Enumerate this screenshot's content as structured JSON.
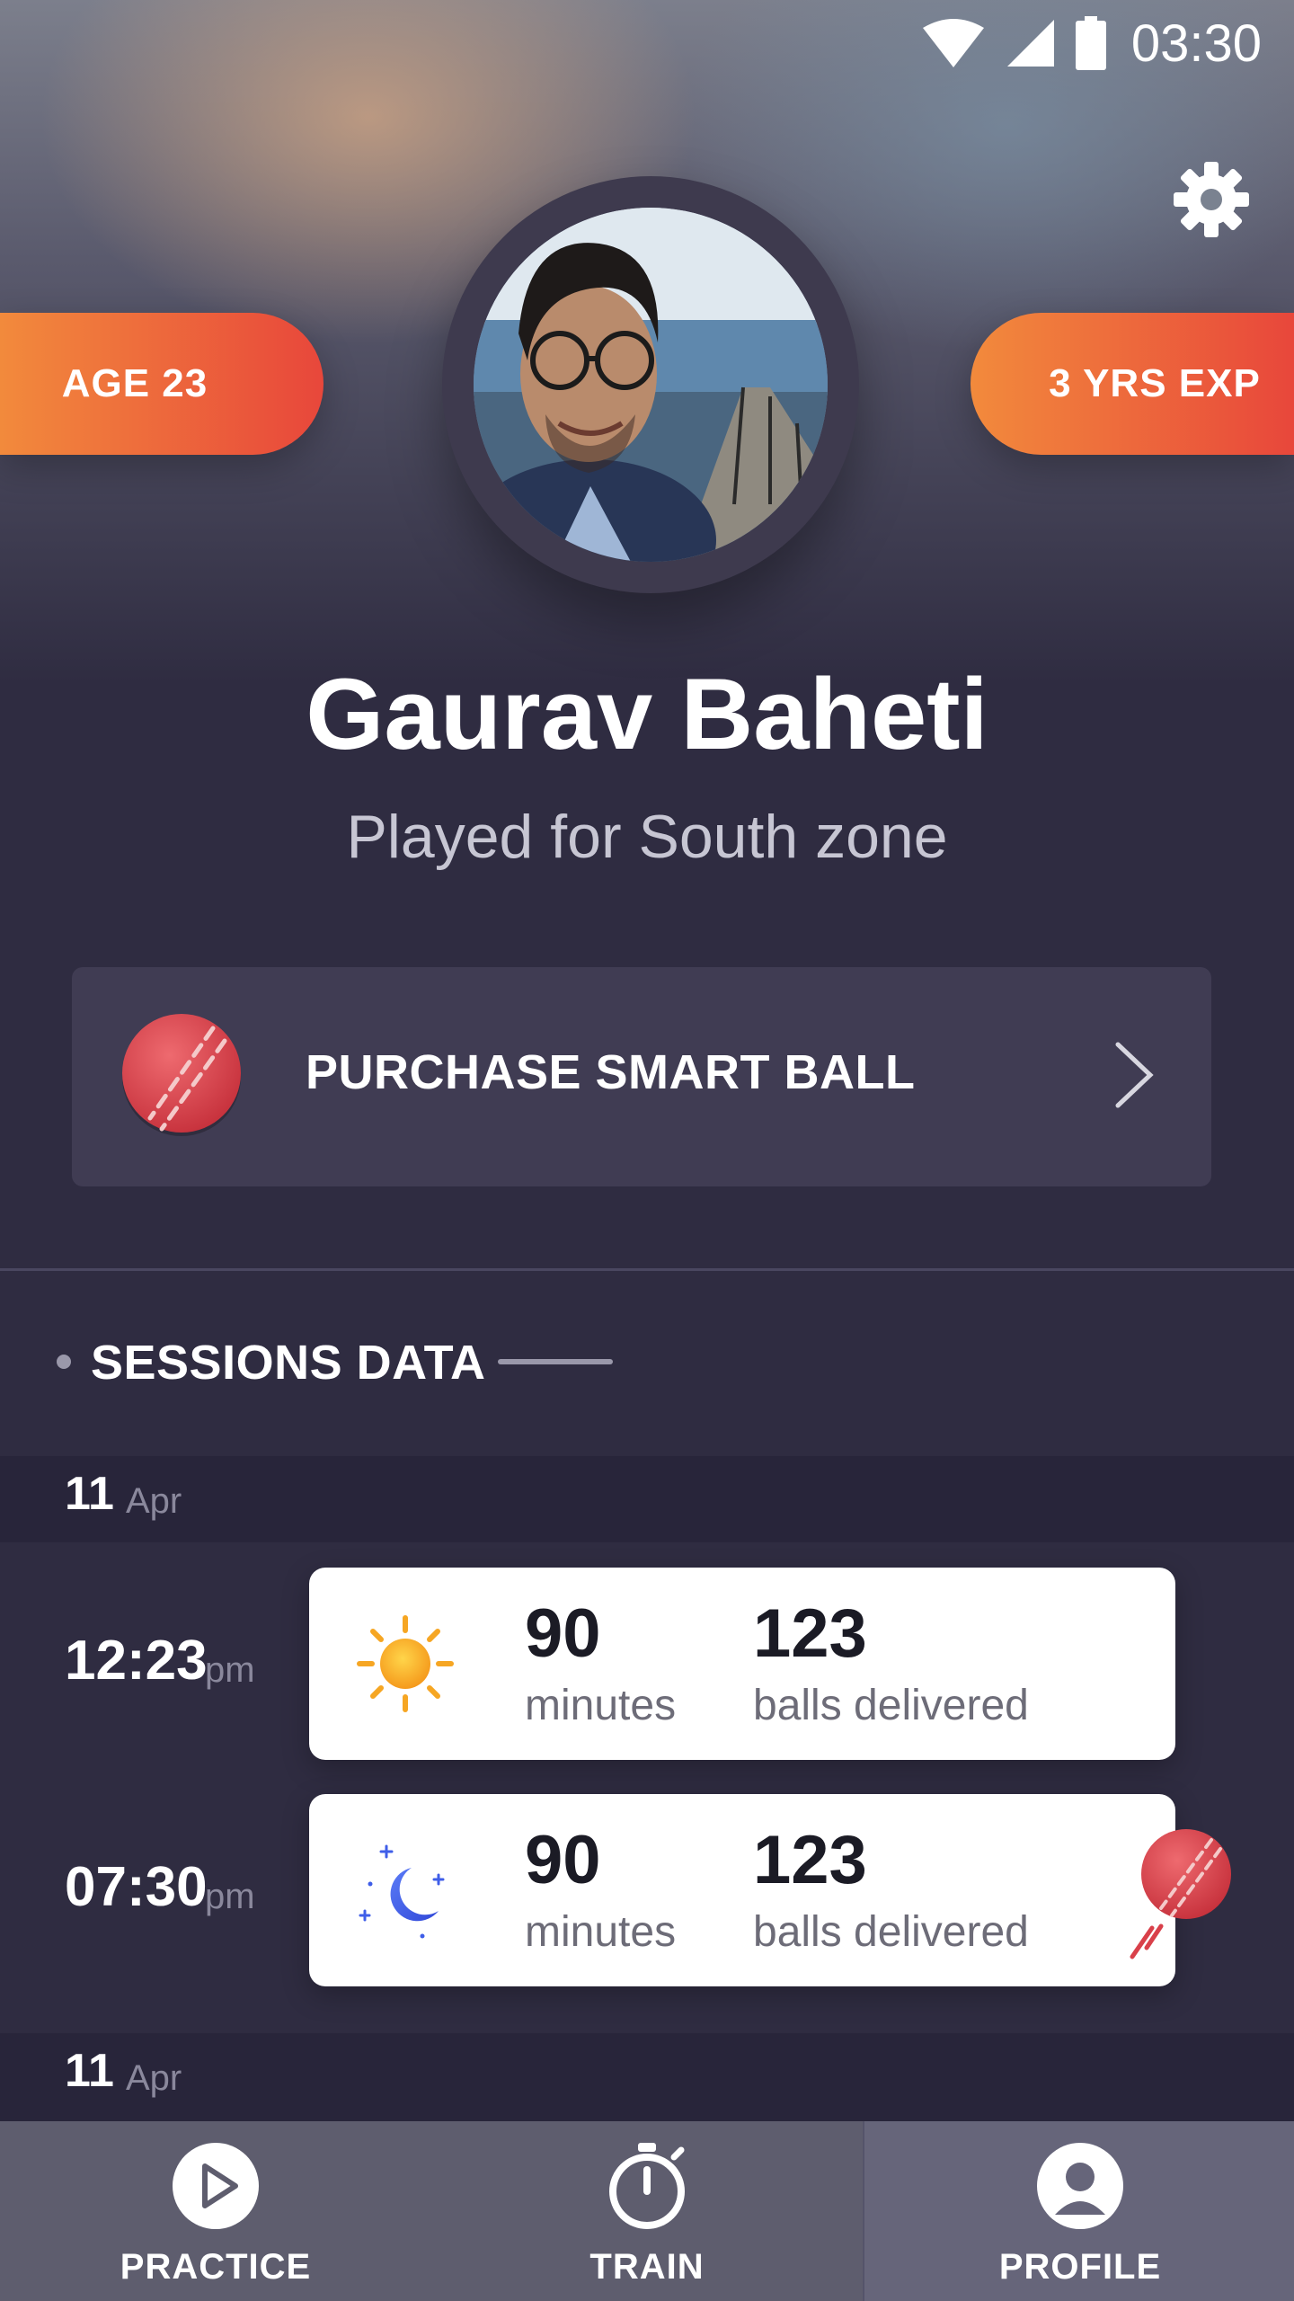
{
  "status_bar": {
    "time": "03:30"
  },
  "profile": {
    "age_badge": "AGE 23",
    "experience_badge": "3 YRS EXP",
    "name": "Gaurav Baheti",
    "subtitle": "Played for South zone"
  },
  "purchase": {
    "label": "PURCHASE SMART BALL"
  },
  "sessions": {
    "title": "SESSIONS DATA",
    "dates": [
      {
        "day": "11",
        "month": "Apr"
      },
      {
        "day": "11",
        "month": "Apr"
      }
    ],
    "items": [
      {
        "time": "12:23",
        "ampm": "pm",
        "icon": "sun-icon",
        "minutes": "90",
        "minutes_label": "minutes",
        "balls": "123",
        "balls_label": "balls delivered"
      },
      {
        "time": "07:30",
        "ampm": "pm",
        "icon": "moon-icon",
        "minutes": "90",
        "minutes_label": "minutes",
        "balls": "123",
        "balls_label": "balls delivered"
      }
    ]
  },
  "nav": {
    "items": [
      {
        "label": "PRACTICE",
        "icon": "play-icon"
      },
      {
        "label": "TRAIN",
        "icon": "stopwatch-icon"
      },
      {
        "label": "PROFILE",
        "icon": "user-icon",
        "active": true
      }
    ]
  },
  "colors": {
    "background": "#2f2c41",
    "accent_orange": "#f28a3c",
    "accent_red": "#e8473b",
    "ball_red": "#d9404a",
    "card_white": "#ffffff"
  }
}
